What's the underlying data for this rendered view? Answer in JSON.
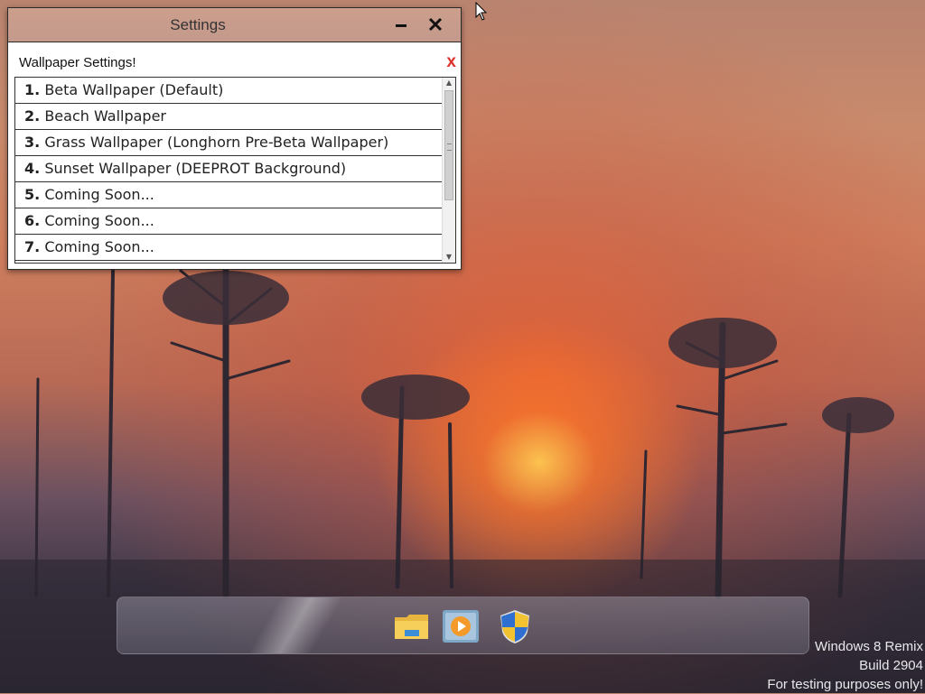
{
  "window": {
    "title": "Settings",
    "minimize_icon": "minimize-icon",
    "close_icon": "close-icon"
  },
  "panel": {
    "heading": "Wallpaper Settings!",
    "close_label": "x"
  },
  "wallpapers": [
    {
      "num": "1.",
      "label": "Beta Wallpaper (Default)"
    },
    {
      "num": "2.",
      "label": "Beach Wallpaper"
    },
    {
      "num": "3.",
      "label": "Grass Wallpaper (Longhorn Pre-Beta Wallpaper)"
    },
    {
      "num": "4.",
      "label": "Sunset Wallpaper (DEEPROT Background)"
    },
    {
      "num": "5.",
      "label": "Coming Soon..."
    },
    {
      "num": "6.",
      "label": "Coming Soon..."
    },
    {
      "num": "7.",
      "label": "Coming Soon..."
    }
  ],
  "taskbar": {
    "icons": [
      "file-explorer-icon",
      "media-player-icon",
      "security-shield-icon"
    ]
  },
  "watermark": {
    "line1": "Windows 8 Remix",
    "line2": "Build 2904",
    "line3": "For testing purposes only!"
  },
  "colors": {
    "accent_close": "#e0322d",
    "titlebar": "#c8968a"
  }
}
